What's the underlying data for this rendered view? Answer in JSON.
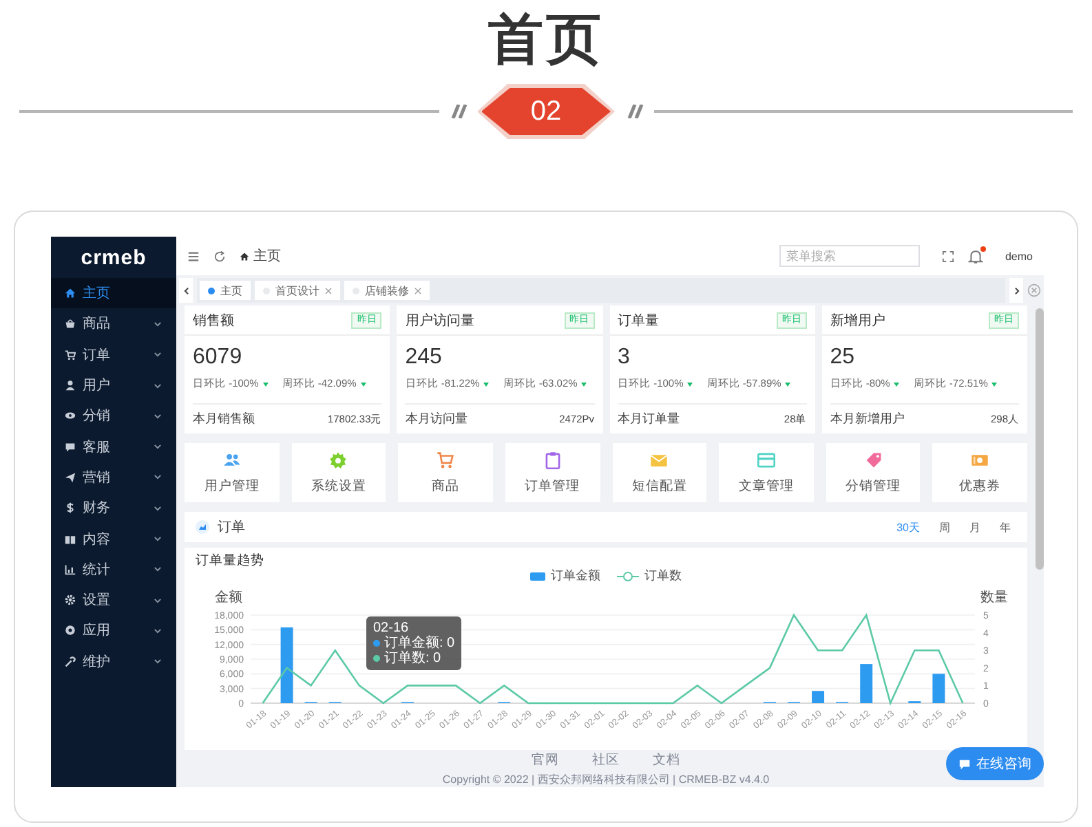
{
  "banner": {
    "title": "首页",
    "number": "02"
  },
  "sidebar": {
    "logo": "crmeb",
    "items": [
      {
        "label": "主页",
        "selected": true,
        "expandable": false
      },
      {
        "label": "商品",
        "selected": false,
        "expandable": true
      },
      {
        "label": "订单",
        "selected": false,
        "expandable": true
      },
      {
        "label": "用户",
        "selected": false,
        "expandable": true
      },
      {
        "label": "分销",
        "selected": false,
        "expandable": true
      },
      {
        "label": "客服",
        "selected": false,
        "expandable": true
      },
      {
        "label": "营销",
        "selected": false,
        "expandable": true
      },
      {
        "label": "财务",
        "selected": false,
        "expandable": true
      },
      {
        "label": "内容",
        "selected": false,
        "expandable": true
      },
      {
        "label": "统计",
        "selected": false,
        "expandable": true
      },
      {
        "label": "设置",
        "selected": false,
        "expandable": true
      },
      {
        "label": "应用",
        "selected": false,
        "expandable": true
      },
      {
        "label": "维护",
        "selected": false,
        "expandable": true
      }
    ]
  },
  "header": {
    "breadcrumb": "主页",
    "search": {
      "placeholder": "菜单搜索"
    },
    "notification": true,
    "user": "demo"
  },
  "tabs": [
    {
      "label": "主页",
      "selected": true,
      "closable": false
    },
    {
      "label": "首页设计",
      "selected": false,
      "closable": true
    },
    {
      "label": "店铺装修",
      "selected": false,
      "closable": true
    }
  ],
  "stats": [
    {
      "title": "销售额",
      "badge": "昨日",
      "value": "6079",
      "day_ratio": "日环比 -100%",
      "week_ratio": "周环比 -42.09%",
      "footer_label": "本月销售额",
      "footer_value": "17802.33元"
    },
    {
      "title": "用户访问量",
      "badge": "昨日",
      "value": "245",
      "day_ratio": "日环比 -81.22%",
      "week_ratio": "周环比 -63.02%",
      "footer_label": "本月访问量",
      "footer_value": "2472Pv"
    },
    {
      "title": "订单量",
      "badge": "昨日",
      "value": "3",
      "day_ratio": "日环比 -100%",
      "week_ratio": "周环比 -57.89%",
      "footer_label": "本月订单量",
      "footer_value": "28单"
    },
    {
      "title": "新增用户",
      "badge": "昨日",
      "value": "25",
      "day_ratio": "日环比 -80%",
      "week_ratio": "周环比 -72.51%",
      "footer_label": "本月新增用户",
      "footer_value": "298人"
    }
  ],
  "shortcuts": [
    {
      "label": "用户管理",
      "color": "#4aa3f0"
    },
    {
      "label": "系统设置",
      "color": "#7ccf2e"
    },
    {
      "label": "商品",
      "color": "#f0874a"
    },
    {
      "label": "订单管理",
      "color": "#a167e8"
    },
    {
      "label": "短信配置",
      "color": "#f5c342"
    },
    {
      "label": "文章管理",
      "color": "#4fd3c4"
    },
    {
      "label": "分销管理",
      "color": "#f06a9a"
    },
    {
      "label": "优惠券",
      "color": "#f5a742"
    }
  ],
  "orders": {
    "title": "订单",
    "periods": [
      {
        "label": "30天",
        "selected": true
      },
      {
        "label": "周",
        "selected": false
      },
      {
        "label": "月",
        "selected": false
      },
      {
        "label": "年",
        "selected": false
      }
    ],
    "amount_chart": {
      "chart_data": {
        "type": "bar",
        "title": "订单量趋势",
        "ylabel": "金额",
        "categories": [
          "01-18",
          "01-19",
          "01-20",
          "01-21",
          "01-22",
          "01-23",
          "01-24",
          "01-25",
          "01-26",
          "01-27",
          "01-28",
          "01-29",
          "01-30",
          "01-31",
          "02-01",
          "02-02",
          "02-03",
          "02-04",
          "02-05",
          "02-06",
          "02-07",
          "02-08",
          "02-09",
          "02-10",
          "02-11",
          "02-12",
          "02-13",
          "02-14",
          "02-15",
          "02-16"
        ],
        "series": [
          {
            "name": "订单金额",
            "color": "#2d9cf0",
            "values": [
              0,
              15500,
              100,
              100,
              0,
              0,
              50,
              0,
              0,
              0,
              50,
              0,
              0,
              0,
              0,
              0,
              0,
              0,
              0,
              0,
              0,
              50,
              200,
              2500,
              50,
              8000,
              0,
              400,
              6000,
              0
            ]
          }
        ],
        "ylim": [
          0,
          18000
        ],
        "grid": true,
        "yticks": [
          {
            "value": 0,
            "label": "0"
          },
          {
            "value": 3000,
            "label": "3,000"
          },
          {
            "value": 6000,
            "label": "6,000"
          },
          {
            "value": 9000,
            "label": "9,000"
          },
          {
            "value": 12000,
            "label": "12,000"
          },
          {
            "value": 15000,
            "label": "15,000"
          },
          {
            "value": 18000,
            "label": "18,000"
          }
        ]
      }
    },
    "count_chart": {
      "chart_data": {
        "type": "line",
        "ylabel": "数量",
        "series": [
          {
            "name": "订单数",
            "color": "#5cc9a7",
            "values": [
              0,
              2,
              1,
              3,
              1,
              0,
              1,
              1,
              1,
              0,
              1,
              0,
              0,
              0,
              0,
              0,
              0,
              0,
              1,
              0,
              1,
              2,
              5,
              3,
              3,
              5,
              0,
              3,
              3,
              0
            ]
          }
        ],
        "ylim": [
          0,
          5
        ],
        "yticks": [
          0,
          1,
          2,
          3,
          4,
          5
        ]
      }
    },
    "tooltip": {
      "title": "02-16",
      "lines": [
        "订单金额: 0",
        "订单数: 0"
      ]
    }
  },
  "footer": {
    "links": [
      "官网",
      "社区",
      "文档"
    ],
    "copyright": "Copyright © 2022 | 西安众邦网络科技有限公司 | CRMEB-BZ v4.4.0"
  },
  "chat_button": "在线咨询"
}
